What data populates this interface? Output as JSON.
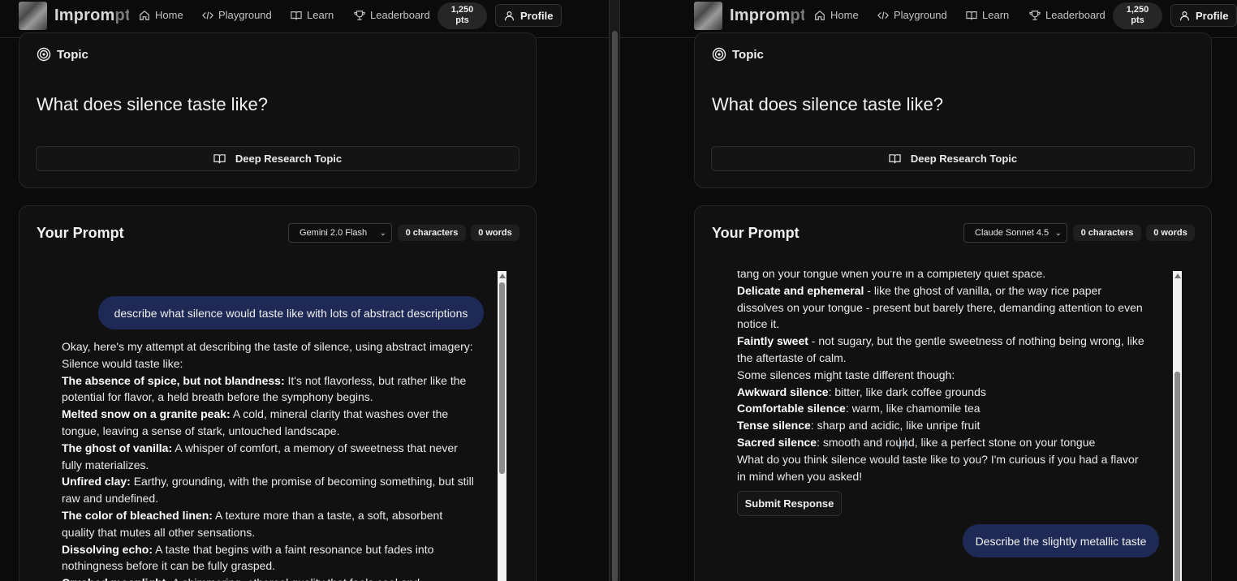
{
  "left": {
    "nav": {
      "brand": "Impromptu",
      "home": "Home",
      "playground": "Playground",
      "learn": "Learn",
      "leaderboard": "Leaderboard",
      "points_value": "1,250",
      "points_unit": "pts",
      "profile": "Profile"
    },
    "topic": {
      "heading": "Topic",
      "question": "What does silence taste like?",
      "research_button": "Deep Research Topic"
    },
    "prompt": {
      "title": "Your Prompt",
      "model": "Gemini 2.0 Flash",
      "characters": "0 characters",
      "words": "0 words"
    },
    "chat": {
      "user_message": "describe what silence would taste like with lots of abstract descriptions",
      "response": [
        {
          "bold": "",
          "text": "Okay, here's my attempt at describing the taste of silence, using abstract imagery:"
        },
        {
          "bold": "",
          "text": "Silence would taste like:"
        },
        {
          "bold": "The absence of spice, but not blandness:",
          "text": " It's not flavorless, but rather like the"
        },
        {
          "bold": "",
          "text": "potential for flavor, a held breath before the symphony begins."
        },
        {
          "bold": "Melted snow on a granite peak:",
          "text": " A cold, mineral clarity that washes over the"
        },
        {
          "bold": "",
          "text": "tongue, leaving a sense of stark, untouched landscape."
        },
        {
          "bold": "The ghost of vanilla:",
          "text": " A whisper of comfort, a memory of sweetness that never"
        },
        {
          "bold": "",
          "text": "fully materializes."
        },
        {
          "bold": "Unfired clay:",
          "text": " Earthy, grounding, with the promise of becoming something, but still"
        },
        {
          "bold": "",
          "text": "raw and undefined."
        },
        {
          "bold": "The color of bleached linen:",
          "text": " A texture more than a taste, a soft, absorbent"
        },
        {
          "bold": "",
          "text": "quality that mutes all other sensations."
        },
        {
          "bold": "Dissolving echo:",
          "text": " A taste that begins with a faint resonance but fades into"
        },
        {
          "bold": "",
          "text": "nothingness before it can be fully grasped."
        },
        {
          "bold": "Crushed moonlight:",
          "text": " A shimmering, ethereal quality that feels cool and"
        }
      ]
    }
  },
  "right": {
    "nav": {
      "brand": "Impromptu",
      "home": "Home",
      "playground": "Playground",
      "learn": "Learn",
      "leaderboard": "Leaderboard",
      "points_value": "1,250",
      "points_unit": "pts",
      "profile": "Profile"
    },
    "topic": {
      "heading": "Topic",
      "question": "What does silence taste like?",
      "research_button": "Deep Research Topic"
    },
    "prompt": {
      "title": "Your Prompt",
      "model": "Claude Sonnet 4.5",
      "characters": "0 characters",
      "words": "0 words"
    },
    "chat": {
      "response": [
        {
          "bold": "",
          "text": "tang on your tongue when you're in a completely quiet space."
        },
        {
          "bold": "Delicate and ephemeral",
          "text": " - like the ghost of vanilla, or the way rice paper"
        },
        {
          "bold": "",
          "text": "dissolves on your tongue - present but barely there, demanding attention to even"
        },
        {
          "bold": "",
          "text": "notice it."
        },
        {
          "bold": "Faintly sweet",
          "text": " - not sugary, but the gentle sweetness of nothing being wrong, like"
        },
        {
          "bold": "",
          "text": "the aftertaste of calm."
        },
        {
          "bold": "",
          "text": "Some silences might taste different though:"
        },
        {
          "bold": "Awkward silence",
          "text": ": bitter, like dark coffee grounds"
        },
        {
          "bold": "Comfortable silence",
          "text": ": warm, like chamomile tea"
        },
        {
          "bold": "Tense silence",
          "text": ": sharp and acidic, like unripe fruit"
        },
        {
          "bold": "Sacred silence",
          "text": ": smooth and round, like a perfect stone on your tongue"
        },
        {
          "bold": "",
          "text": "What do you think silence would taste like to you? I'm curious if you had a flavor"
        },
        {
          "bold": "",
          "text": "in mind when you asked!"
        }
      ],
      "submit_button": "Submit Response",
      "user_message": "Describe the slightly metallic taste"
    }
  },
  "colors": {
    "background": "#0b0b0b",
    "card": "#111111",
    "user_bubble": "#1e2a55",
    "pill": "#262626"
  }
}
